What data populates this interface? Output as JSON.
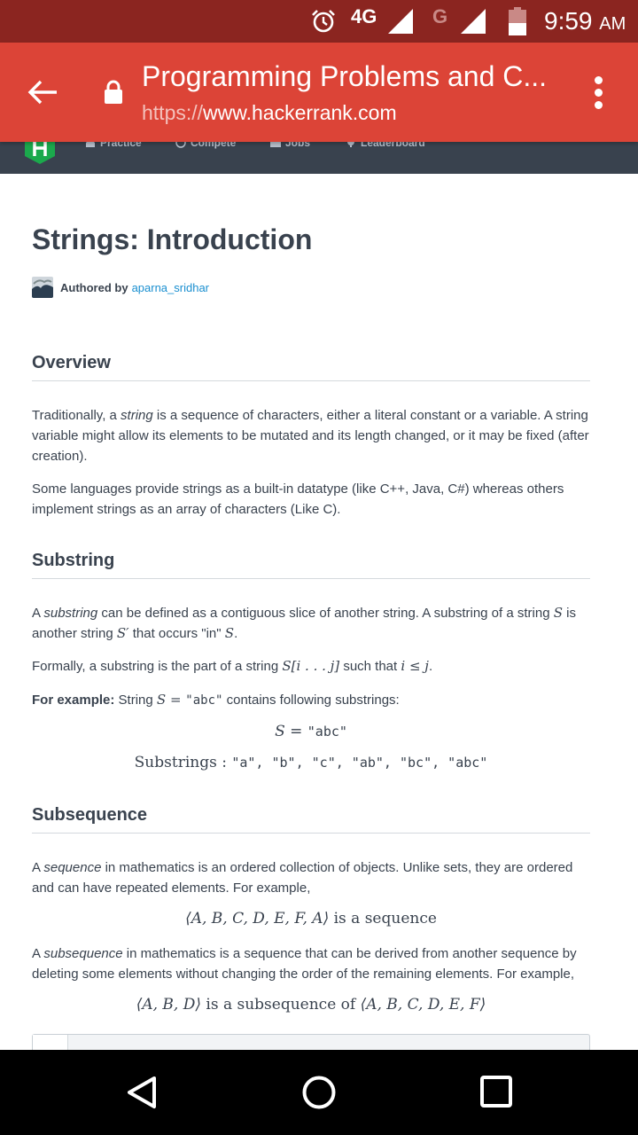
{
  "status_bar": {
    "network": "4G",
    "network2": "G",
    "time": "9:59",
    "ampm": "AM",
    "icons": [
      "alarm-icon",
      "signal-icon",
      "signal-icon",
      "battery-icon"
    ]
  },
  "browser": {
    "title": "Programming Problems and C...",
    "url_scheme": "https://",
    "url_host": "www.hackerrank.com"
  },
  "site_nav": {
    "items": [
      {
        "label": "Practice",
        "icon": "home-icon"
      },
      {
        "label": "Compete",
        "icon": "clock-icon"
      },
      {
        "label": "Jobs",
        "icon": "briefcase-icon"
      },
      {
        "label": "Leaderboard",
        "icon": "trophy-icon"
      }
    ]
  },
  "article": {
    "title": "Strings: Introduction",
    "author_prefix": "Authored by",
    "author_name": "aparna_sridhar",
    "sections": {
      "overview": {
        "heading": "Overview",
        "p1_a": "Traditionally, a ",
        "p1_em": "string",
        "p1_b": " is a sequence of characters, either a literal constant or a variable. A string variable might allow its elements to be mutated and its length changed, or it may be fixed (after creation).",
        "p2": "Some languages provide strings as a built-in datatype (like C++, Java, C#) whereas others implement strings as an array of characters (Like C)."
      },
      "substring": {
        "heading": "Substring",
        "p1_a": "A ",
        "p1_em": "substring",
        "p1_b": " can be defined as a contiguous slice of another string. A substring of a string ",
        "p1_s": "S",
        "p1_c": " is another string ",
        "p1_s2": "S′",
        "p1_d": " that occurs \"in\" ",
        "p1_s3": "S",
        "p1_e": ".",
        "p2_a": "Formally, a substring is the part of a string ",
        "p2_m1": "S[i . . . j]",
        "p2_b": " such that ",
        "p2_m2": "i ≤ j",
        "p2_c": ".",
        "p3_bold": "For example:",
        "p3_a": " String ",
        "p3_m": "S = ",
        "p3_code": "\"abc\"",
        "p3_b": " contains following substrings:",
        "eq1_lhs": "S = ",
        "eq1_rhs": "\"abc\"",
        "eq2_label": "Substrings : ",
        "eq2_items": "\"a\", \"b\", \"c\", \"ab\", \"bc\", \"abc\""
      },
      "subsequence": {
        "heading": "Subsequence",
        "p1_a": "A ",
        "p1_em": "sequence",
        "p1_b": " in mathematics is an ordered collection of objects. Unlike sets, they are ordered and can have repeated elements. For example,",
        "eq1_m": "⟨A, B, C, D, E, F, A⟩",
        "eq1_t": " is a sequence",
        "p2_a": "A ",
        "p2_em": "subsequence",
        "p2_b": " in mathematics is a sequence that can be derived from another sequence by deleting some elements without changing the order of the remaining elements. For example,",
        "eq2_m1": "⟨A, B, D⟩",
        "eq2_t": " is a subsequence of ",
        "eq2_m2": "⟨A, B, C, D, E, F⟩"
      }
    }
  },
  "system_nav": {
    "icons": [
      "back-triangle-icon",
      "home-circle-icon",
      "recents-square-icon"
    ]
  }
}
